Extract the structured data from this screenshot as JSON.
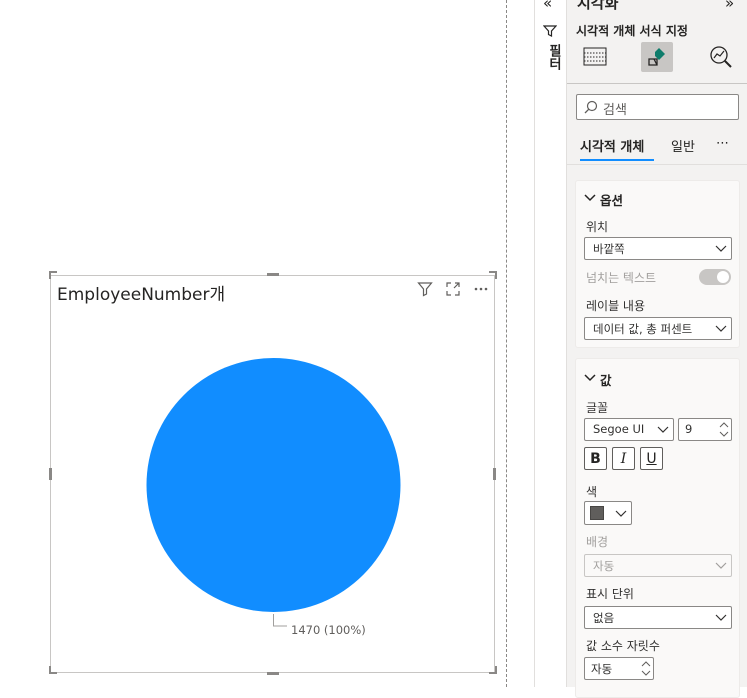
{
  "canvas": {
    "visual_title": "EmployeeNumber개",
    "chart_data": {
      "type": "pie",
      "slices": [
        {
          "label": "1470 (100%)",
          "value": 1470,
          "percent": 100,
          "color": "#118DFF"
        }
      ]
    }
  },
  "filter_strip": {
    "label": "필터",
    "collapse_glyph": "«"
  },
  "pane": {
    "title": "시각화",
    "expand_glyph": "»",
    "subtitle": "시각적 개체 서식 지정",
    "search_placeholder": "검색",
    "tabs": {
      "visual": "시각적 개체",
      "general": "일반",
      "more": "⋯"
    },
    "options": {
      "header": "옵션",
      "position_label": "위치",
      "position_value": "바깥쪽",
      "overflow_label": "넘치는 텍스트",
      "label_content_label": "레이블 내용",
      "label_content_value": "데이터 값, 총 퍼센트"
    },
    "values": {
      "header": "값",
      "font_label": "글꼴",
      "font_value": "Segoe UI",
      "font_size": "9",
      "bold": "B",
      "italic": "I",
      "underline": "U",
      "color_label": "색",
      "color_value": "#605E5C",
      "background_label": "배경",
      "background_value": "자동",
      "display_units_label": "표시 단위",
      "display_units_value": "없음",
      "decimals_label": "값 소수 자릿수",
      "decimals_value": "자동"
    }
  }
}
